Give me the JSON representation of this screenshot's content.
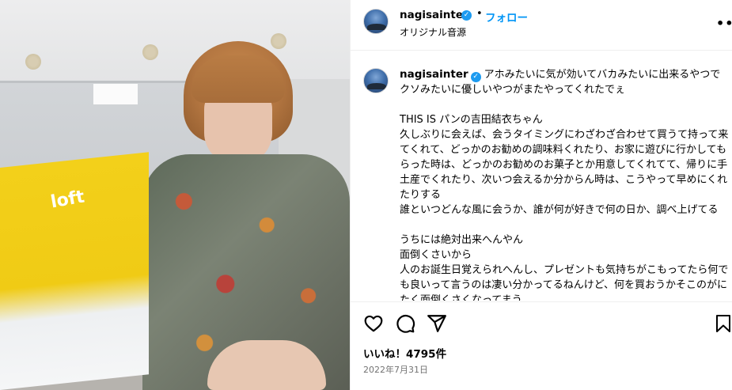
{
  "post": {
    "username": "nagisainter",
    "follow_label": "フォロー",
    "separator": "•",
    "audio_label": "オリジナル音源",
    "more_icon": "more-options-icon"
  },
  "media": {
    "bag_logo_text": "loft"
  },
  "caption": {
    "username": "nagisainter",
    "lines": [
      "アホみたいに気が効いてバカみたいに出来るやつでクソみたいに優しいやつがまたやってくれたでぇ",
      "",
      "THIS IS パンの吉田結衣ちゃん",
      "久しぶりに会えば、会うタイミングにわざわざ合わせて買うて持って来てくれて、どっかのお勧めの調味料くれたり、お家に遊びに行かしてもらった時は、どっかのお勧めのお菓子とか用意してくれてて、帰りに手土産でくれたり、次いつ会えるか分からん時は、こうやって早めにくれたりする",
      "誰といつどんな風に会うか、誰が何が好きで何の日か、調べ上げてる",
      "",
      "うちには絶対出来へんやん",
      "面倒くさいから",
      "人のお誕生日覚えられへんし、プレゼントも気持ちがこもってたら何でも良いって言うのは凄い分かってるねんけど、何を買おうかそこのがにたく面倒くさくなってまう"
    ]
  },
  "actions": {
    "icons": [
      "heart-icon",
      "comment-icon",
      "share-icon",
      "bookmark-icon"
    ]
  },
  "stats": {
    "likes": "いいね！4795件",
    "date": "2022年7月31日"
  },
  "colors": {
    "link_blue": "#0095f6",
    "verified_blue": "#1d9bf0",
    "muted": "#737373",
    "divider": "#efefef"
  }
}
